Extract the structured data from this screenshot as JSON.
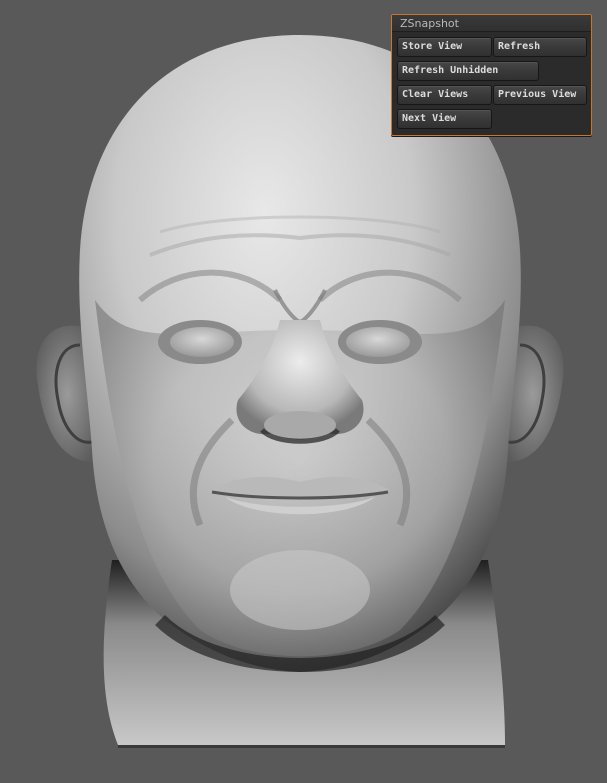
{
  "panel": {
    "title": "ZSnapshot",
    "buttons": {
      "store_view": "Store View",
      "refresh": "Refresh",
      "refresh_unhidden": "Refresh Unhidden",
      "clear_views": "Clear Views",
      "previous_view": "Previous View",
      "next_view": "Next View"
    },
    "border_color": "#c9752a"
  },
  "canvas": {
    "background_color": "#595959",
    "model": "sculpted-head-render"
  }
}
